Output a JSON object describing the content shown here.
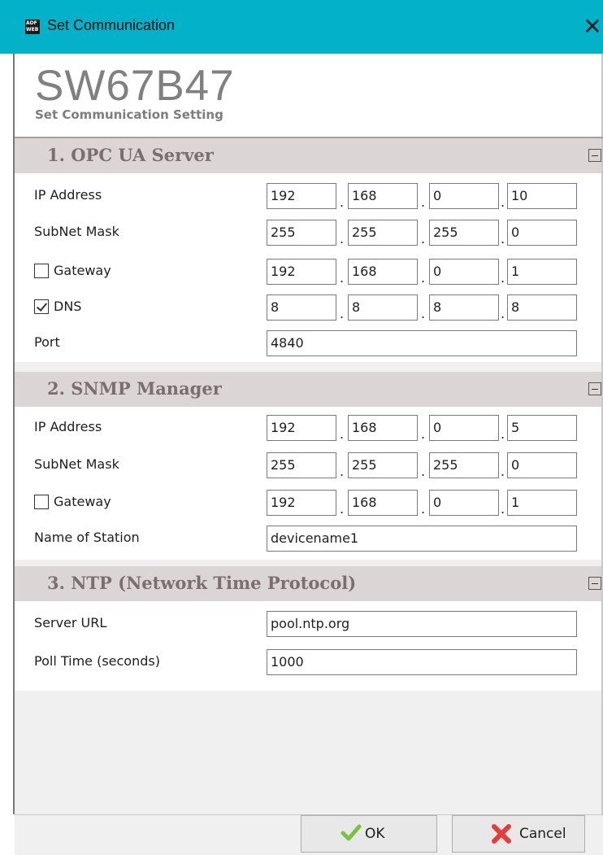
{
  "window": {
    "title": "Set Communication",
    "icon_text_top": "ADF",
    "icon_text_bottom": "WEB"
  },
  "header": {
    "device": "SW67B47",
    "subtitle": "Set Communication Setting"
  },
  "opcua": {
    "title": "1. OPC UA Server",
    "ip_label": "IP Address",
    "ip": [
      "192",
      "168",
      "0",
      "10"
    ],
    "mask_label": "SubNet Mask",
    "mask": [
      "255",
      "255",
      "255",
      "0"
    ],
    "gateway_label": "Gateway",
    "gateway_checked": false,
    "gateway": [
      "192",
      "168",
      "0",
      "1"
    ],
    "dns_label": "DNS",
    "dns_checked": true,
    "dns": [
      "8",
      "8",
      "8",
      "8"
    ],
    "port_label": "Port",
    "port": "4840"
  },
  "snmp": {
    "title": "2. SNMP Manager",
    "ip_label": "IP Address",
    "ip": [
      "192",
      "168",
      "0",
      "5"
    ],
    "mask_label": "SubNet Mask",
    "mask": [
      "255",
      "255",
      "255",
      "0"
    ],
    "gateway_label": "Gateway",
    "gateway_checked": false,
    "gateway": [
      "192",
      "168",
      "0",
      "1"
    ],
    "station_label": "Name of Station",
    "station": "devicename1"
  },
  "ntp": {
    "title": "3. NTP (Network Time Protocol)",
    "url_label": "Server URL",
    "url": "pool.ntp.org",
    "poll_label": "Poll Time (seconds)",
    "poll": "1000"
  },
  "buttons": {
    "ok": "OK",
    "cancel": "Cancel"
  },
  "colors": {
    "titlebar": "#03b1c8",
    "section_bar": "#dcd5d5",
    "ok_icon": "#7cc242",
    "cancel_icon": "#e53c3c"
  },
  "icons": {
    "ok": "checkmark-icon",
    "cancel": "x-icon",
    "collapse": "minus-box-icon",
    "close": "close-icon"
  }
}
